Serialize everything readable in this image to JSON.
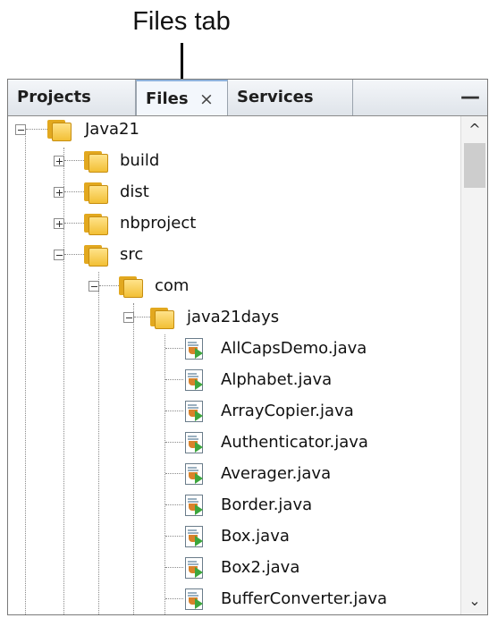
{
  "callout": {
    "text": "Files tab"
  },
  "tabs": {
    "projects": "Projects",
    "files": "Files",
    "files_close": "×",
    "services": "Services",
    "minimize": "—"
  },
  "tree": {
    "root": "Java21",
    "children": {
      "build": "build",
      "dist": "dist",
      "nbproject": "nbproject",
      "src": "src",
      "com": "com",
      "java21days": "java21days"
    },
    "files": [
      "AllCapsDemo.java",
      "Alphabet.java",
      "ArrayCopier.java",
      "Authenticator.java",
      "Averager.java",
      "Border.java",
      "Box.java",
      "Box2.java",
      "BufferConverter.java"
    ]
  },
  "scrollbar": {
    "up_glyph": "^",
    "down_glyph": "⌄"
  }
}
